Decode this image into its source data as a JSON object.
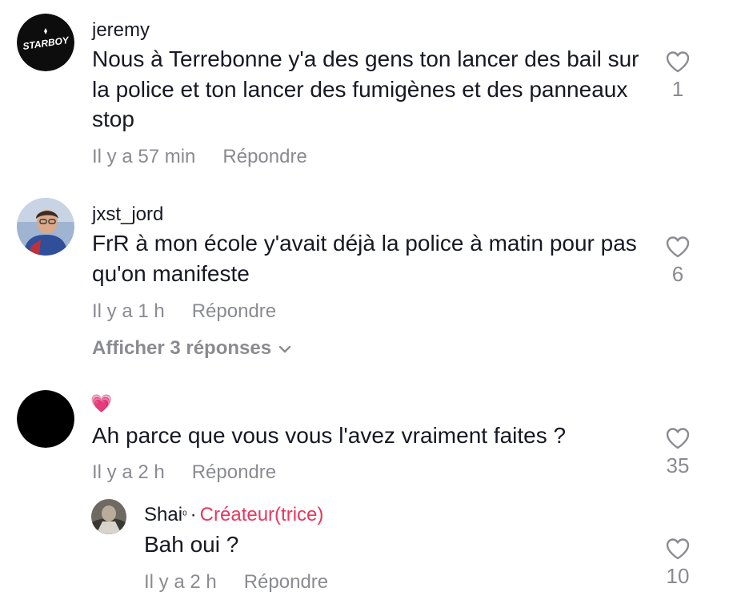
{
  "comments": [
    {
      "username": "jeremy",
      "avatar_logo_text": "STARBOY",
      "text": "Nous à Terrebonne y'a des gens ton lancer des bail sur la police et ton lancer des fumigènes et des panneaux stop",
      "time": "Il y a 57 min",
      "reply_label": "Répondre",
      "likes": "1"
    },
    {
      "username": "jxst_jord",
      "text": "FrR à mon école y'avait déjà la police à matin pour pas qu'on manifeste",
      "time": "Il y a 1 h",
      "reply_label": "Répondre",
      "likes": "6",
      "view_replies": "Afficher 3 réponses"
    },
    {
      "username_emoji": "💗",
      "text": "Ah parce que vous vous l'avez vraiment faites ?",
      "time": "Il y a 2 h",
      "reply_label": "Répondre",
      "likes": "35",
      "reply": {
        "username": "Shai",
        "username_suffix": "⁰",
        "separator": "·",
        "creator_badge": "Créateur(trice)",
        "text": "Bah oui ?",
        "time": "Il y a 2 h",
        "reply_label": "Répondre",
        "likes": "10"
      }
    }
  ],
  "colors": {
    "primary_text": "#161823",
    "secondary_text": "#8a8b91",
    "creator_accent": "#e8375f"
  },
  "icons": [
    "heart-outline-icon",
    "chevron-down-icon"
  ]
}
